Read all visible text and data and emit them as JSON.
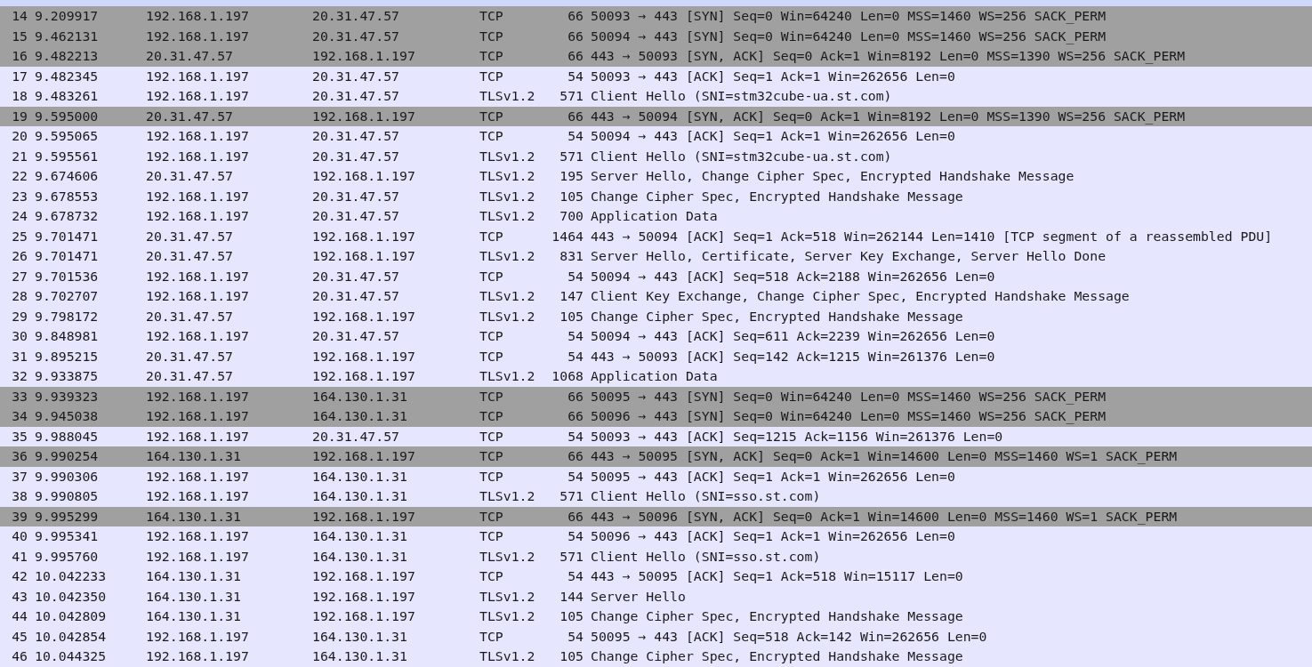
{
  "packets": [
    {
      "no": "14",
      "time": "9.209917",
      "source": "192.168.1.197",
      "destination": "20.31.47.57",
      "protocol": "TCP",
      "length": "66",
      "info": "50093 → 443 [SYN] Seq=0 Win=64240 Len=0 MSS=1460 WS=256 SACK_PERM",
      "color": "#a0a0a0"
    },
    {
      "no": "15",
      "time": "9.462131",
      "source": "192.168.1.197",
      "destination": "20.31.47.57",
      "protocol": "TCP",
      "length": "66",
      "info": "50094 → 443 [SYN] Seq=0 Win=64240 Len=0 MSS=1460 WS=256 SACK_PERM",
      "color": "#a0a0a0"
    },
    {
      "no": "16",
      "time": "9.482213",
      "source": "20.31.47.57",
      "destination": "192.168.1.197",
      "protocol": "TCP",
      "length": "66",
      "info": "443 → 50093 [SYN, ACK] Seq=0 Ack=1 Win=8192 Len=0 MSS=1390 WS=256 SACK_PERM",
      "color": "#a0a0a0"
    },
    {
      "no": "17",
      "time": "9.482345",
      "source": "192.168.1.197",
      "destination": "20.31.47.57",
      "protocol": "TCP",
      "length": "54",
      "info": "50093 → 443 [ACK] Seq=1 Ack=1 Win=262656 Len=0",
      "color": "#e7e6ff"
    },
    {
      "no": "18",
      "time": "9.483261",
      "source": "192.168.1.197",
      "destination": "20.31.47.57",
      "protocol": "TLSv1.2",
      "length": "571",
      "info": "Client Hello (SNI=stm32cube-ua.st.com)",
      "color": "#e7e6ff"
    },
    {
      "no": "19",
      "time": "9.595000",
      "source": "20.31.47.57",
      "destination": "192.168.1.197",
      "protocol": "TCP",
      "length": "66",
      "info": "443 → 50094 [SYN, ACK] Seq=0 Ack=1 Win=8192 Len=0 MSS=1390 WS=256 SACK_PERM",
      "color": "#a0a0a0"
    },
    {
      "no": "20",
      "time": "9.595065",
      "source": "192.168.1.197",
      "destination": "20.31.47.57",
      "protocol": "TCP",
      "length": "54",
      "info": "50094 → 443 [ACK] Seq=1 Ack=1 Win=262656 Len=0",
      "color": "#e7e6ff"
    },
    {
      "no": "21",
      "time": "9.595561",
      "source": "192.168.1.197",
      "destination": "20.31.47.57",
      "protocol": "TLSv1.2",
      "length": "571",
      "info": "Client Hello (SNI=stm32cube-ua.st.com)",
      "color": "#e7e6ff"
    },
    {
      "no": "22",
      "time": "9.674606",
      "source": "20.31.47.57",
      "destination": "192.168.1.197",
      "protocol": "TLSv1.2",
      "length": "195",
      "info": "Server Hello, Change Cipher Spec, Encrypted Handshake Message",
      "color": "#e7e6ff"
    },
    {
      "no": "23",
      "time": "9.678553",
      "source": "192.168.1.197",
      "destination": "20.31.47.57",
      "protocol": "TLSv1.2",
      "length": "105",
      "info": "Change Cipher Spec, Encrypted Handshake Message",
      "color": "#e7e6ff"
    },
    {
      "no": "24",
      "time": "9.678732",
      "source": "192.168.1.197",
      "destination": "20.31.47.57",
      "protocol": "TLSv1.2",
      "length": "700",
      "info": "Application Data",
      "color": "#e7e6ff"
    },
    {
      "no": "25",
      "time": "9.701471",
      "source": "20.31.47.57",
      "destination": "192.168.1.197",
      "protocol": "TCP",
      "length": "1464",
      "info": "443 → 50094 [ACK] Seq=1 Ack=518 Win=262144 Len=1410 [TCP segment of a reassembled PDU]",
      "color": "#e7e6ff"
    },
    {
      "no": "26",
      "time": "9.701471",
      "source": "20.31.47.57",
      "destination": "192.168.1.197",
      "protocol": "TLSv1.2",
      "length": "831",
      "info": "Server Hello, Certificate, Server Key Exchange, Server Hello Done",
      "color": "#e7e6ff"
    },
    {
      "no": "27",
      "time": "9.701536",
      "source": "192.168.1.197",
      "destination": "20.31.47.57",
      "protocol": "TCP",
      "length": "54",
      "info": "50094 → 443 [ACK] Seq=518 Ack=2188 Win=262656 Len=0",
      "color": "#e7e6ff"
    },
    {
      "no": "28",
      "time": "9.702707",
      "source": "192.168.1.197",
      "destination": "20.31.47.57",
      "protocol": "TLSv1.2",
      "length": "147",
      "info": "Client Key Exchange, Change Cipher Spec, Encrypted Handshake Message",
      "color": "#e7e6ff"
    },
    {
      "no": "29",
      "time": "9.798172",
      "source": "20.31.47.57",
      "destination": "192.168.1.197",
      "protocol": "TLSv1.2",
      "length": "105",
      "info": "Change Cipher Spec, Encrypted Handshake Message",
      "color": "#e7e6ff"
    },
    {
      "no": "30",
      "time": "9.848981",
      "source": "192.168.1.197",
      "destination": "20.31.47.57",
      "protocol": "TCP",
      "length": "54",
      "info": "50094 → 443 [ACK] Seq=611 Ack=2239 Win=262656 Len=0",
      "color": "#e7e6ff"
    },
    {
      "no": "31",
      "time": "9.895215",
      "source": "20.31.47.57",
      "destination": "192.168.1.197",
      "protocol": "TCP",
      "length": "54",
      "info": "443 → 50093 [ACK] Seq=142 Ack=1215 Win=261376 Len=0",
      "color": "#e7e6ff"
    },
    {
      "no": "32",
      "time": "9.933875",
      "source": "20.31.47.57",
      "destination": "192.168.1.197",
      "protocol": "TLSv1.2",
      "length": "1068",
      "info": "Application Data",
      "color": "#e7e6ff"
    },
    {
      "no": "33",
      "time": "9.939323",
      "source": "192.168.1.197",
      "destination": "164.130.1.31",
      "protocol": "TCP",
      "length": "66",
      "info": "50095 → 443 [SYN] Seq=0 Win=64240 Len=0 MSS=1460 WS=256 SACK_PERM",
      "color": "#a0a0a0"
    },
    {
      "no": "34",
      "time": "9.945038",
      "source": "192.168.1.197",
      "destination": "164.130.1.31",
      "protocol": "TCP",
      "length": "66",
      "info": "50096 → 443 [SYN] Seq=0 Win=64240 Len=0 MSS=1460 WS=256 SACK_PERM",
      "color": "#a0a0a0"
    },
    {
      "no": "35",
      "time": "9.988045",
      "source": "192.168.1.197",
      "destination": "20.31.47.57",
      "protocol": "TCP",
      "length": "54",
      "info": "50093 → 443 [ACK] Seq=1215 Ack=1156 Win=261376 Len=0",
      "color": "#e7e6ff"
    },
    {
      "no": "36",
      "time": "9.990254",
      "source": "164.130.1.31",
      "destination": "192.168.1.197",
      "protocol": "TCP",
      "length": "66",
      "info": "443 → 50095 [SYN, ACK] Seq=0 Ack=1 Win=14600 Len=0 MSS=1460 WS=1 SACK_PERM",
      "color": "#a0a0a0"
    },
    {
      "no": "37",
      "time": "9.990306",
      "source": "192.168.1.197",
      "destination": "164.130.1.31",
      "protocol": "TCP",
      "length": "54",
      "info": "50095 → 443 [ACK] Seq=1 Ack=1 Win=262656 Len=0",
      "color": "#e7e6ff"
    },
    {
      "no": "38",
      "time": "9.990805",
      "source": "192.168.1.197",
      "destination": "164.130.1.31",
      "protocol": "TLSv1.2",
      "length": "571",
      "info": "Client Hello (SNI=sso.st.com)",
      "color": "#e7e6ff"
    },
    {
      "no": "39",
      "time": "9.995299",
      "source": "164.130.1.31",
      "destination": "192.168.1.197",
      "protocol": "TCP",
      "length": "66",
      "info": "443 → 50096 [SYN, ACK] Seq=0 Ack=1 Win=14600 Len=0 MSS=1460 WS=1 SACK_PERM",
      "color": "#a0a0a0"
    },
    {
      "no": "40",
      "time": "9.995341",
      "source": "192.168.1.197",
      "destination": "164.130.1.31",
      "protocol": "TCP",
      "length": "54",
      "info": "50096 → 443 [ACK] Seq=1 Ack=1 Win=262656 Len=0",
      "color": "#e7e6ff"
    },
    {
      "no": "41",
      "time": "9.995760",
      "source": "192.168.1.197",
      "destination": "164.130.1.31",
      "protocol": "TLSv1.2",
      "length": "571",
      "info": "Client Hello (SNI=sso.st.com)",
      "color": "#e7e6ff"
    },
    {
      "no": "42",
      "time": "10.042233",
      "source": "164.130.1.31",
      "destination": "192.168.1.197",
      "protocol": "TCP",
      "length": "54",
      "info": "443 → 50095 [ACK] Seq=1 Ack=518 Win=15117 Len=0",
      "color": "#e7e6ff"
    },
    {
      "no": "43",
      "time": "10.042350",
      "source": "164.130.1.31",
      "destination": "192.168.1.197",
      "protocol": "TLSv1.2",
      "length": "144",
      "info": "Server Hello",
      "color": "#e7e6ff"
    },
    {
      "no": "44",
      "time": "10.042809",
      "source": "164.130.1.31",
      "destination": "192.168.1.197",
      "protocol": "TLSv1.2",
      "length": "105",
      "info": "Change Cipher Spec, Encrypted Handshake Message",
      "color": "#e7e6ff"
    },
    {
      "no": "45",
      "time": "10.042854",
      "source": "192.168.1.197",
      "destination": "164.130.1.31",
      "protocol": "TCP",
      "length": "54",
      "info": "50095 → 443 [ACK] Seq=518 Ack=142 Win=262656 Len=0",
      "color": "#e7e6ff"
    },
    {
      "no": "46",
      "time": "10.044325",
      "source": "192.168.1.197",
      "destination": "164.130.1.31",
      "protocol": "TLSv1.2",
      "length": "105",
      "info": "Change Cipher Spec, Encrypted Handshake Message",
      "color": "#e7e6ff"
    }
  ]
}
